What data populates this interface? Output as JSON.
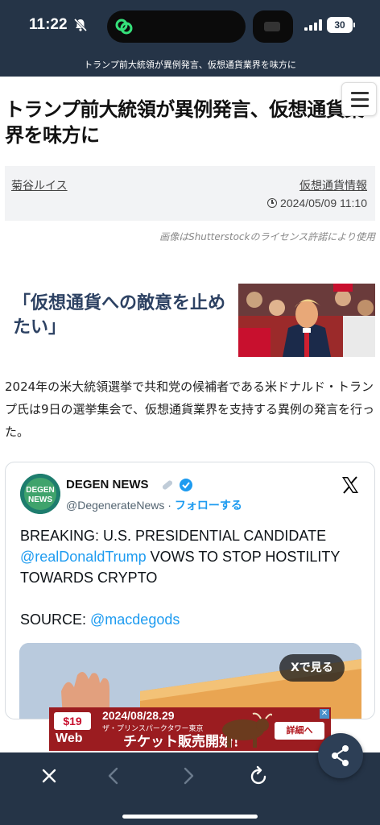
{
  "status_bar": {
    "time": "11:22",
    "battery": "30",
    "icons": [
      "bell-slash-icon",
      "link-icon",
      "signal-icon",
      "battery-icon"
    ]
  },
  "browser": {
    "page_title": "トランプ前大統領が異例発言、仮想通貨業界を味方に"
  },
  "article": {
    "headline": "トランプ前大統領が異例発言、仮想通貨業界を味方に",
    "author": "菊谷ルイス",
    "category": "仮想通貨情報",
    "date": "2024/05/09 11:10",
    "image_credit": "画像はShutterstockのライセンス許諾により使用",
    "subheading": "「仮想通貨への敵意を止めたい」",
    "body": "2024年の米大統領選挙で共和党の候補者である米ドナルド・トランプ氏は9日の選挙集会で、仮想通貨業界を支持する異例の発言を行った。"
  },
  "tweet": {
    "account_name": "DEGEN NEWS",
    "handle": "@DegenerateNews",
    "separator": " · ",
    "follow_label": "フォローする",
    "text_1": "BREAKING: U.S. PRESIDENTIAL CANDIDATE ",
    "mention_1": "@realDonaldTrump",
    "text_2": " VOWS TO STOP HOSTILITY TOWARDS CRYPTO",
    "source_label": "SOURCE: ",
    "mention_2": "@macdegods",
    "view_on_x": "Xで見る",
    "avatar_text_1": "DEGEN",
    "avatar_text_2": "NEWS"
  },
  "ad": {
    "price": "$19",
    "brand": "Web",
    "date": "2024/08/28.29",
    "venue": "ザ・プリンスパークタワー東京",
    "sale": "チケット販売開始！",
    "detail_label": "詳細へ",
    "year_mark": "2024"
  },
  "colors": {
    "header_bg": "#253447",
    "subhead": "#2d4263",
    "link_blue": "#1d9bf0",
    "ad_red": "#9b1c20"
  }
}
